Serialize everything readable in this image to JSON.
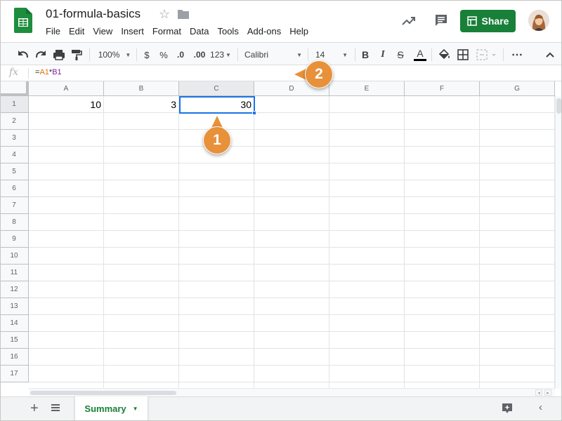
{
  "app": {
    "title": "01-formula-basics",
    "share_label": "Share",
    "menu": [
      "File",
      "Edit",
      "View",
      "Insert",
      "Format",
      "Data",
      "Tools",
      "Add-ons",
      "Help"
    ],
    "brand_color": "#188038"
  },
  "toolbar": {
    "zoom": "100%",
    "currency": "$",
    "percent": "%",
    "decrease_decimal": ".0",
    "increase_decimal": ".00",
    "more_formats": "123",
    "font": "Calibri",
    "font_size": "14",
    "bold": "B",
    "italic": "I",
    "strikethrough": "S",
    "text_color": "A"
  },
  "formula_bar": {
    "fx": "fx",
    "formula_prefix": "=",
    "ref1": "A1",
    "operator": "*",
    "ref2": "B1"
  },
  "grid": {
    "columns": [
      "A",
      "B",
      "C",
      "D",
      "E",
      "F",
      "G"
    ],
    "rows": [
      "1",
      "2",
      "3",
      "4",
      "5",
      "6",
      "7",
      "8",
      "9",
      "10",
      "11",
      "12",
      "13",
      "14",
      "15",
      "16",
      "17"
    ],
    "active_cell": "C1",
    "cells": {
      "A1": "10",
      "B1": "3",
      "C1": "30"
    }
  },
  "sheets": {
    "tabs": [
      "Summary"
    ],
    "active": "Summary"
  },
  "callouts": {
    "one": "1",
    "two": "2"
  }
}
